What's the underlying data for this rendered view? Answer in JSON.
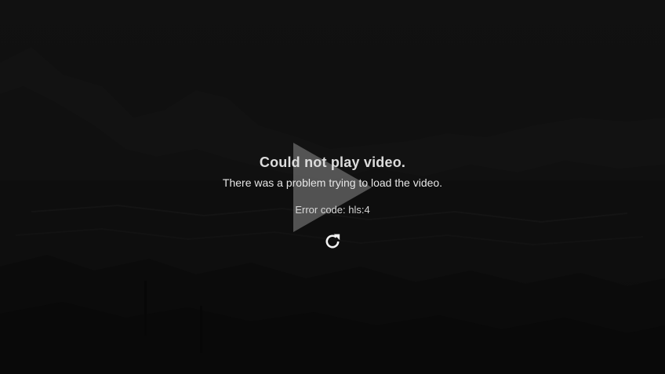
{
  "player": {
    "error": {
      "title": "Could not play video.",
      "message": "There was a problem trying to load the video.",
      "code_text": "Error code: hls:4"
    },
    "icons": {
      "play": "play-icon",
      "retry": "retry-icon"
    },
    "colors": {
      "background": "#141414",
      "text": "#e2e2e2",
      "play_icon": "#8a8a8a"
    }
  }
}
